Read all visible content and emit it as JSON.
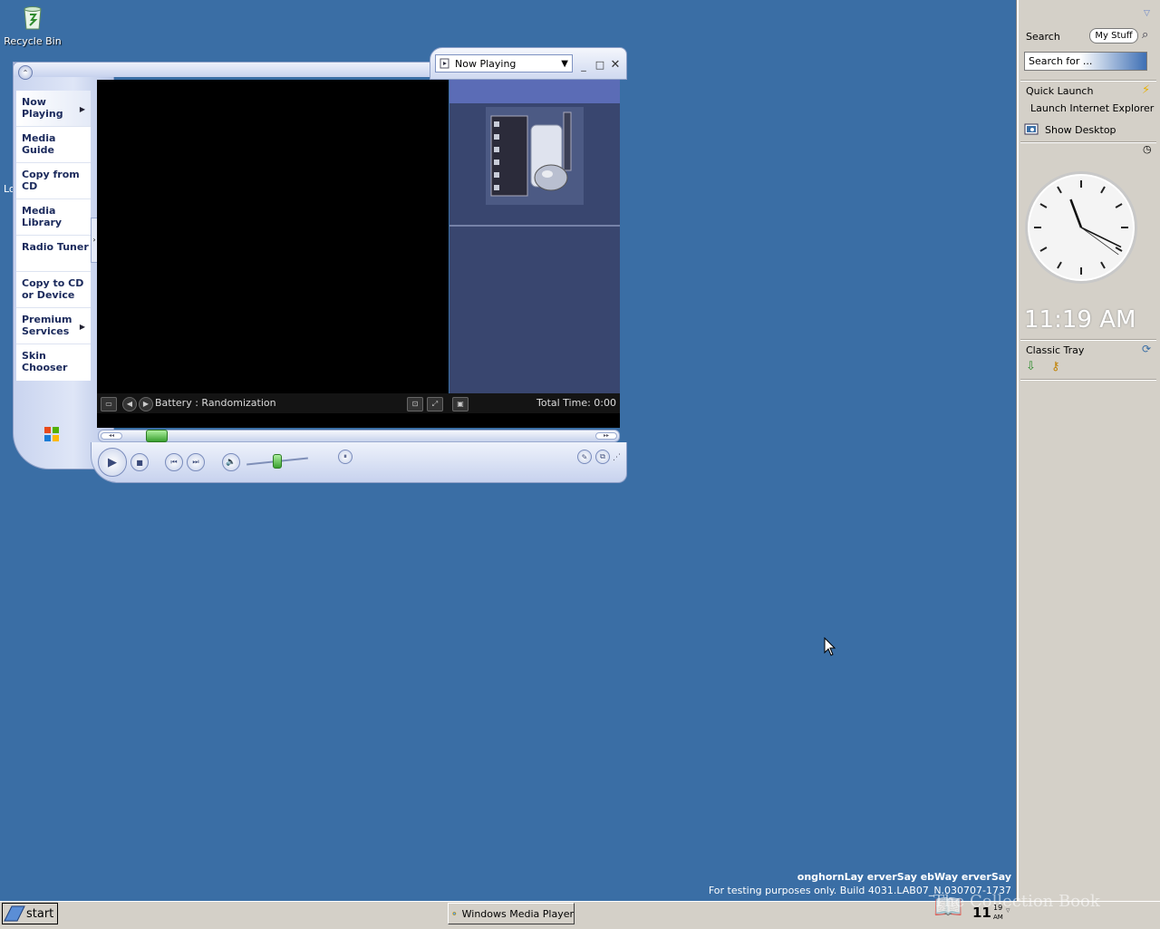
{
  "desktop": {
    "recycle_bin_label": "Recycle Bin",
    "partial_label": "Lo"
  },
  "wmp": {
    "view_dropdown": "Now Playing",
    "taskpane": [
      "Now Playing",
      "Media Guide",
      "Copy from CD",
      "Media Library",
      "Radio Tuner",
      "Copy to CD or Device",
      "Premium Services",
      "Skin Chooser"
    ],
    "track_info": "Battery : Randomization",
    "total_time": "Total Time: 0:00",
    "seek_fraction": 0.06,
    "volume_fraction": 0.45
  },
  "sidebar": {
    "search_label": "Search",
    "my_stuff": "My Stuff",
    "search_placeholder": "Search for ...",
    "quick_launch_label": "Quick Launch",
    "ql_items": [
      "Launch Internet Explorer Browser",
      "Show Desktop"
    ],
    "clock": {
      "hour": 11,
      "minute": 19,
      "second": 21
    },
    "digital_time": "11:19 AM",
    "classic_tray_label": "Classic Tray"
  },
  "watermark": {
    "line1": "onghornLay erverSay ebWay erverSay",
    "line2": "For testing purposes only. Build 4031.LAB07_N.030707-1737"
  },
  "taskbar": {
    "start_label": "start",
    "wmp_task": "Windows Media Player",
    "tray_time_hour": "11",
    "tray_time_min": "19",
    "tray_ampm": "AM",
    "collection_text": "The Collection Book"
  },
  "colors": {
    "desktop_bg": "#3a6ea5",
    "sidebar_bg": "#d4d0c8",
    "wmp_accent": "#5b6cb6"
  }
}
